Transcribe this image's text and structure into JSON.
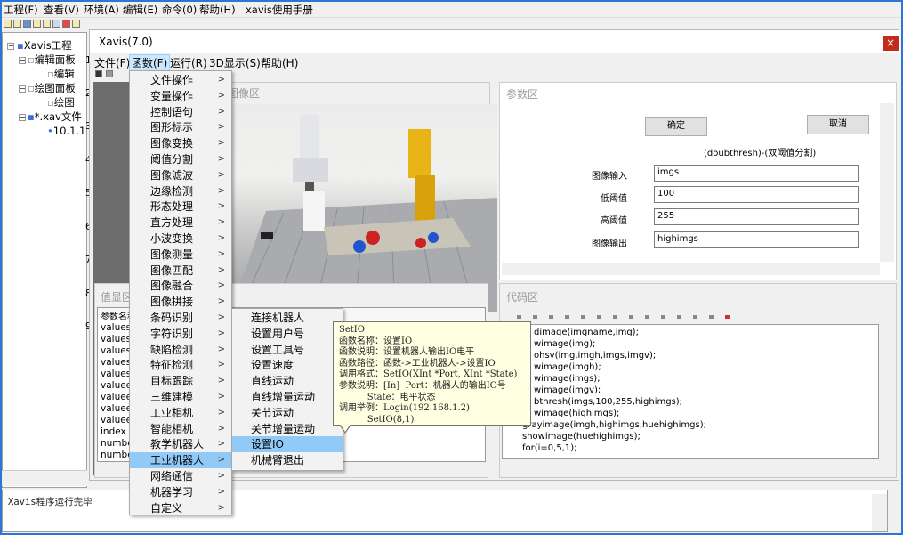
{
  "outer_menu": [
    "工程(F)",
    "查看(V)",
    "环境(A)",
    "编辑(E)",
    "命令(0)",
    "帮助(H)",
    "xavis使用手册"
  ],
  "tree": {
    "root": "Xavis工程",
    "items": [
      "编辑面板",
      "编辑",
      "绘图面板",
      "绘图",
      "*.xav文件",
      "10.1.1"
    ]
  },
  "line_numbers": [
    "1",
    "2",
    "3",
    "4",
    "5",
    "6",
    "7",
    "8",
    "9"
  ],
  "log_text": "Xavis程序运行完毕",
  "xavis": {
    "title": "Xavis(7.0)",
    "close": "×",
    "menu": [
      "文件(F)",
      "函数(F)",
      "运行(R)",
      "3D显示(S)",
      "帮助(H)"
    ]
  },
  "image_panel": {
    "title": "图像区"
  },
  "value_panel": {
    "title": "值显区",
    "header": "参数名称",
    "rows": [
      "valuest.",
      "valuest.",
      "valuest.",
      "valuest.",
      "valuest.",
      "valueen",
      "valueen",
      "valueen",
      "valueen",
      "index",
      "number.",
      "number."
    ]
  },
  "param_panel": {
    "title": "参数区",
    "ok": "确定",
    "cancel": "取消",
    "func_desc": "(doubthresh)-(双阈值分割)",
    "params": [
      {
        "label": "图像输入",
        "value": "imgs"
      },
      {
        "label": "低阈值",
        "value": "100"
      },
      {
        "label": "高阈值",
        "value": "255"
      },
      {
        "label": "图像输出",
        "value": "highimgs"
      }
    ]
  },
  "code_panel": {
    "title": "代码区",
    "lines": [
      "dimage(imgname,img);",
      "wimage(img);",
      "ohsv(img,imgh,imgs,imgv);",
      "wimage(imgh);",
      "wimage(imgs);",
      "wimage(imgv);",
      "bthresh(imgs,100,255,highimgs);",
      "wimage(highimgs);",
      "grayimage(imgh,highimgs,huehighimgs);",
      "showimage(huehighimgs);",
      "for(i=0,5,1);"
    ]
  },
  "function_menu": {
    "items": [
      "文件操作",
      "变量操作",
      "控制语句",
      "图形标示",
      "图像变换",
      "阈值分割",
      "图像滤波",
      "边缘检测",
      "形态处理",
      "直方处理",
      "小波变换",
      "图像测量",
      "图像匹配",
      "图像融合",
      "图像拼接",
      "条码识别",
      "字符识别",
      "缺陷检测",
      "特征检测",
      "目标跟踪",
      "三维建模",
      "工业相机",
      "智能相机",
      "教学机器人",
      "工业机器人",
      "网络通信",
      "机器学习",
      "自定义"
    ],
    "selected_index": 24,
    "arrow": ">"
  },
  "robot_submenu": {
    "items": [
      "连接机器人",
      "设置用户号",
      "设置工具号",
      "设置速度",
      "直线运动",
      "直线增量运动",
      "关节运动",
      "关节增量运动",
      "设置IO",
      "机械臂退出"
    ],
    "selected_index": 8
  },
  "tooltip": {
    "lines": [
      "SetIO",
      "函数名称：设置IO",
      "函数说明：设置机器人输出IO电平",
      "函数路径：函数->工业机器人->设置IO",
      "调用格式：SetIO(XInt *Port, XInt *State)",
      "参数说明：[In]  Port：机器人的输出IO号",
      "          State：电平状态",
      "调用举例：Login(192.168.1.2)",
      "          SetIO(8,1)"
    ]
  }
}
